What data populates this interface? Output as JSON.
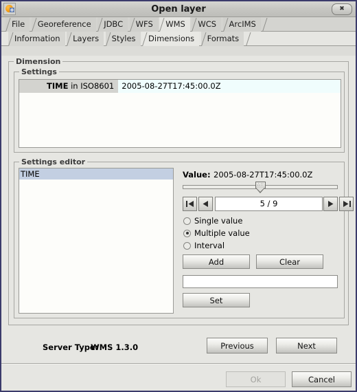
{
  "window": {
    "title": "Open layer",
    "icon": "globe-plus-icon",
    "close_label": "✖"
  },
  "outer_tabs": [
    {
      "label": "File",
      "selected": false
    },
    {
      "label": "Georeference",
      "selected": false
    },
    {
      "label": "JDBC",
      "selected": false
    },
    {
      "label": "WFS",
      "selected": false
    },
    {
      "label": "WMS",
      "selected": true
    },
    {
      "label": "WCS",
      "selected": false
    },
    {
      "label": "ArcIMS",
      "selected": false
    }
  ],
  "inner_tabs": [
    {
      "label": "Information",
      "selected": false
    },
    {
      "label": "Layers",
      "selected": false
    },
    {
      "label": "Styles",
      "selected": false
    },
    {
      "label": "Dimensions",
      "selected": true
    },
    {
      "label": "Formats",
      "selected": false
    }
  ],
  "dimension_group": {
    "title": "Dimension",
    "settings_group": {
      "title": "Settings",
      "rows": [
        {
          "key_name": "TIME",
          "key_suffix": " in ISO8601",
          "value": "2005-08-27T17:45:00.0Z"
        }
      ]
    },
    "settings_editor": {
      "title": "Settings editor",
      "list_items": [
        {
          "label": "TIME",
          "selected": true
        }
      ],
      "value_label": "Value:",
      "value_text": "2005-08-27T17:45:00.0Z",
      "slider": {
        "position_percent": 50,
        "min": 1,
        "max": 9,
        "current": 5
      },
      "nav": {
        "first_label": "first-page",
        "prev_label": "previous-page",
        "counter": "5 / 9",
        "next_label": "next-page",
        "last_label": "last-page"
      },
      "radios": [
        {
          "label": "Single value",
          "checked": false
        },
        {
          "label": "Multiple value",
          "checked": true
        },
        {
          "label": "Interval",
          "checked": false
        }
      ],
      "add_label": "Add",
      "clear_label": "Clear",
      "entry_value": "",
      "entry_placeholder": "",
      "set_label": "Set"
    }
  },
  "footer": {
    "server_type_label": "Server Type:",
    "server_type_value": "WMS 1.3.0",
    "previous_label": "Previous",
    "next_label": "Next",
    "ok_label": "Ok",
    "ok_disabled": true,
    "cancel_label": "Cancel"
  },
  "colors": {
    "window_bg": "#dcdcd8",
    "titlebar": "#c6c6c2",
    "frame_border": "#3b3b6b",
    "selection": "#c3cfe2",
    "value_band": "#f0fdfd",
    "key_band": "#d3d3cf"
  }
}
